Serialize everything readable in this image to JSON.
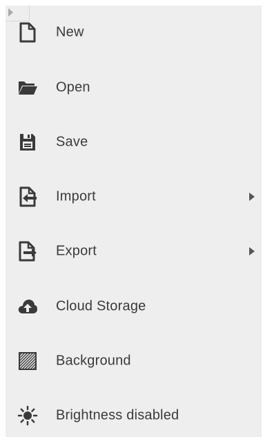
{
  "menu": {
    "items": [
      {
        "label": "New",
        "icon": "new-file-icon",
        "has_submenu": false
      },
      {
        "label": "Open",
        "icon": "folder-open-icon",
        "has_submenu": false
      },
      {
        "label": "Save",
        "icon": "save-icon",
        "has_submenu": false
      },
      {
        "label": "Import",
        "icon": "import-icon",
        "has_submenu": true
      },
      {
        "label": "Export",
        "icon": "export-icon",
        "has_submenu": true
      },
      {
        "label": "Cloud Storage",
        "icon": "cloud-upload-icon",
        "has_submenu": false
      },
      {
        "label": "Background",
        "icon": "background-pattern-icon",
        "has_submenu": false
      },
      {
        "label": "Brightness disabled",
        "icon": "brightness-icon",
        "has_submenu": false
      }
    ]
  },
  "colors": {
    "menu_background": "#eeeeee",
    "icon": "#3a3a3a",
    "label": "#3a3a3a"
  }
}
